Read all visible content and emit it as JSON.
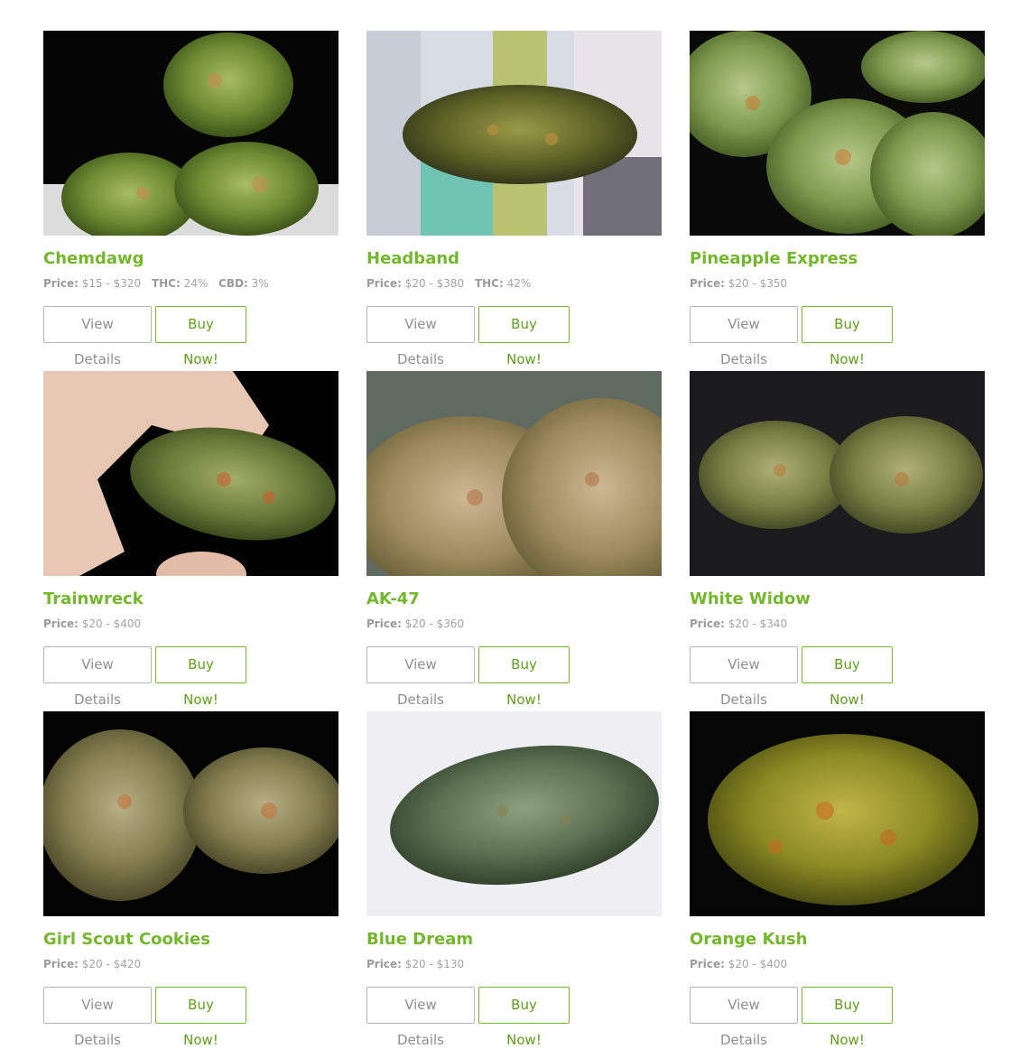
{
  "labels": {
    "price_key": "Price:",
    "thc_key": "THC:",
    "cbd_key": "CBD:",
    "view_details": "View Details",
    "buy_now": "Buy Now!"
  },
  "colors": {
    "accent_green": "#73b72c",
    "button_gray_border": "#b5b5b5",
    "text_gray": "#a3a3a3"
  },
  "products": [
    {
      "name": "Chemdawg",
      "price": "$15 - $320",
      "thc": "24%",
      "cbd": "3%",
      "photo": "cannabis-bud-photo"
    },
    {
      "name": "Headband",
      "price": "$20 - $380",
      "thc": "42%",
      "photo": "cannabis-bud-photo"
    },
    {
      "name": "Pineapple Express",
      "price": "$20 - $350",
      "photo": "cannabis-bud-photo"
    },
    {
      "name": "Trainwreck",
      "price": "$20 - $400",
      "photo": "cannabis-bud-in-hand-photo"
    },
    {
      "name": "AK-47",
      "price": "$20 - $360",
      "photo": "cannabis-bud-photo"
    },
    {
      "name": "White Widow",
      "price": "$20 - $340",
      "photo": "cannabis-bud-photo"
    },
    {
      "name": "Girl Scout Cookies",
      "price": "$20 - $420",
      "photo": "cannabis-bud-photo"
    },
    {
      "name": "Blue Dream",
      "price": "$20 - $130",
      "photo": "cannabis-bud-photo"
    },
    {
      "name": "Orange Kush",
      "price": "$20 - $400",
      "photo": "cannabis-bud-photo"
    }
  ]
}
